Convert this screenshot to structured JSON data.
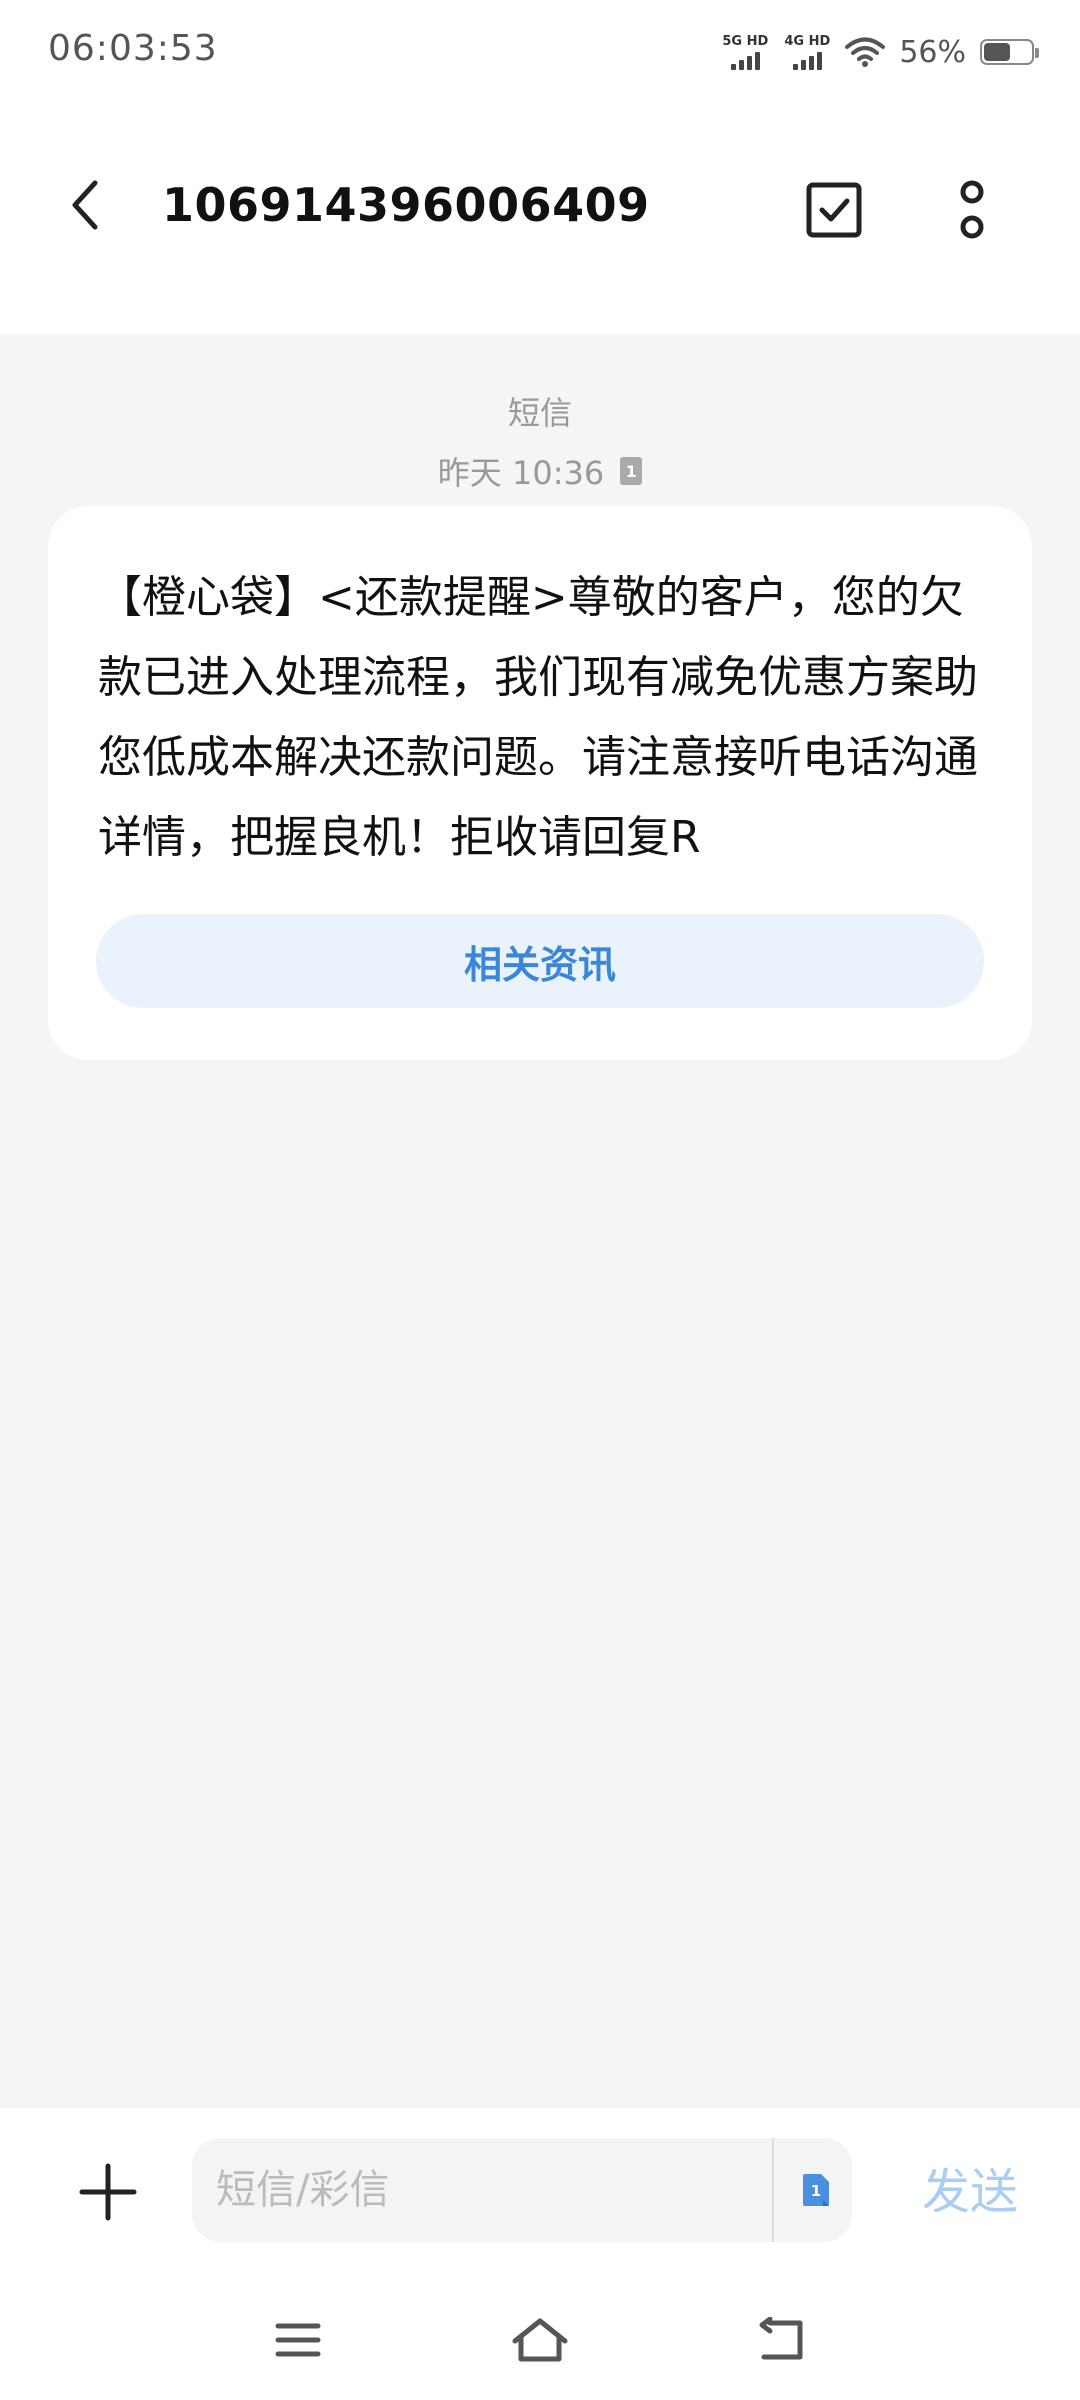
{
  "status_bar": {
    "time": "06:03:53",
    "signal1_label": "5G HD",
    "signal2_label": "4G HD",
    "battery_percent": "56%",
    "battery_level": 0.56
  },
  "header": {
    "title": "106914396006409"
  },
  "message": {
    "type_label": "短信",
    "time_label": "昨天 10:36",
    "sim_number": "1",
    "body": "【橙心袋】<还款提醒>尊敬的客户，您的欠款已进入处理流程，我们现有减免优惠方案助您低成本解决还款问题。请注意接听电话沟通详情，把握良机！拒收请回复R",
    "info_button_label": "相关资讯"
  },
  "composer": {
    "placeholder": "短信/彩信",
    "sim_number": "1",
    "send_label": "发送"
  },
  "colors": {
    "accent": "#3a86d8",
    "send_disabled": "#a9cdf3",
    "conversation_bg": "#f5f5f5"
  }
}
